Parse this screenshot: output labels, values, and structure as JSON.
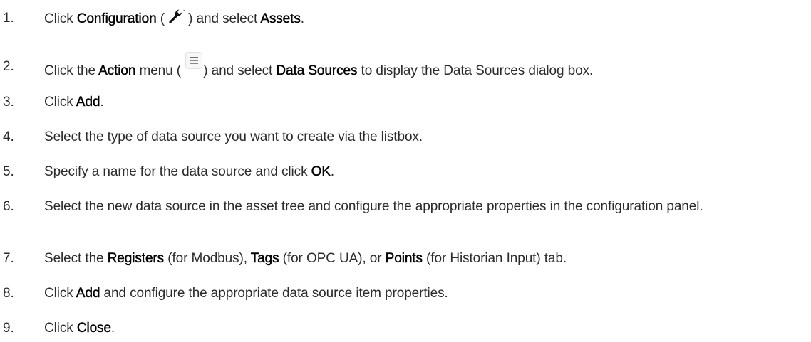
{
  "steps": [
    {
      "number": "1.",
      "parts": [
        {
          "t": "Click "
        },
        {
          "b": "Configuration"
        },
        {
          "t": " ( "
        },
        {
          "icon": "wrench-dropdown-icon"
        },
        {
          "t": ") and select "
        },
        {
          "b": "Assets"
        },
        {
          "t": "."
        }
      ]
    },
    {
      "number": "2.",
      "parts": [
        {
          "t": "Click the "
        },
        {
          "b": "Action"
        },
        {
          "t": " menu ( "
        },
        {
          "icon": "action-menu-icon"
        },
        {
          "t": ") and select "
        },
        {
          "b": "Data Sources"
        },
        {
          "t": " to display the Data Sources dialog box."
        }
      ]
    },
    {
      "number": "3.",
      "parts": [
        {
          "t": "Click "
        },
        {
          "b": "Add"
        },
        {
          "t": "."
        }
      ]
    },
    {
      "number": "4.",
      "parts": [
        {
          "t": "Select the type of data source you want to create via the listbox."
        }
      ]
    },
    {
      "number": "5.",
      "parts": [
        {
          "t": "Specify a name for the data source and click "
        },
        {
          "b": "OK"
        },
        {
          "t": "."
        }
      ]
    },
    {
      "number": "6.",
      "parts": [
        {
          "t": "Select the new data source in the asset tree and configure the appropriate properties in the configuration panel."
        }
      ]
    },
    {
      "number": "7.",
      "parts": [
        {
          "t": "Select the "
        },
        {
          "b": "Registers"
        },
        {
          "t": " (for Modbus), "
        },
        {
          "b": "Tags"
        },
        {
          "t": " (for OPC UA), or "
        },
        {
          "b": "Points"
        },
        {
          "t": " (for Historian Input) tab."
        }
      ]
    },
    {
      "number": "8.",
      "parts": [
        {
          "t": "Click "
        },
        {
          "b": "Add"
        },
        {
          "t": " and configure the appropriate data source item properties."
        }
      ]
    },
    {
      "number": "9.",
      "parts": [
        {
          "t": "Click "
        },
        {
          "b": "Close"
        },
        {
          "t": "."
        }
      ]
    }
  ]
}
